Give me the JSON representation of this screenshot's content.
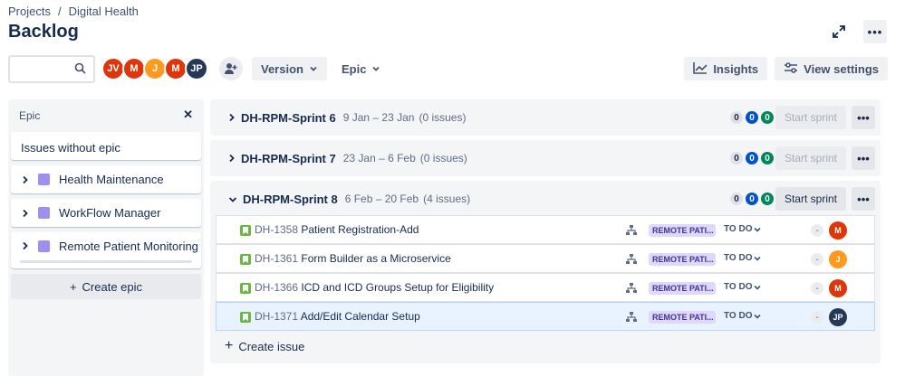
{
  "breadcrumb": {
    "items": [
      "Projects",
      "/",
      "Digital Health"
    ]
  },
  "page": {
    "title": "Backlog"
  },
  "search": {
    "placeholder": "",
    "value": ""
  },
  "avatars": [
    {
      "initials": "JV",
      "color": "#de350b"
    },
    {
      "initials": "M",
      "color": "#de350b"
    },
    {
      "initials": "J",
      "color": "#ff991f"
    },
    {
      "initials": "M",
      "color": "#de350b"
    },
    {
      "initials": "JP",
      "color": "#253858"
    }
  ],
  "toolbar": {
    "version_label": "Version",
    "epic_label": "Epic",
    "insights_label": "Insights",
    "view_settings_label": "View settings"
  },
  "epic_panel": {
    "title": "Epic",
    "without_epic": "Issues without epic",
    "epics": [
      {
        "label": "Health Maintenance",
        "color": "#9f8fef"
      },
      {
        "label": "WorkFlow Manager",
        "color": "#9f8fef"
      },
      {
        "label": "Remote Patient Monitoring",
        "color": "#9f8fef"
      }
    ],
    "create_label": "Create epic"
  },
  "sprints": [
    {
      "name": "DH-RPM-Sprint 6",
      "dates": "9 Jan – 23 Jan",
      "issues_count": "(0 issues)",
      "counts": [
        "0",
        "0",
        "0"
      ],
      "start_label": "Start sprint",
      "expanded": false
    },
    {
      "name": "DH-RPM-Sprint 7",
      "dates": "23 Jan – 6 Feb",
      "issues_count": "(0 issues)",
      "counts": [
        "0",
        "0",
        "0"
      ],
      "start_label": "Start sprint",
      "expanded": false
    },
    {
      "name": "DH-RPM-Sprint 8",
      "dates": "6 Feb – 20 Feb",
      "issues_count": "(4 issues)",
      "counts": [
        "0",
        "0",
        "0"
      ],
      "start_label": "Start sprint",
      "expanded": true
    }
  ],
  "issues": [
    {
      "key": "DH-1358",
      "summary": "Patient Registration-Add",
      "epic": "REMOTE PATI...",
      "status": "TO DO",
      "estimate": "-",
      "assignee": "M",
      "assignee_color": "#de350b"
    },
    {
      "key": "DH-1361",
      "summary": "Form Builder as a Microservice",
      "epic": "REMOTE PATI...",
      "status": "TO DO",
      "estimate": "-",
      "assignee": "J",
      "assignee_color": "#ff991f"
    },
    {
      "key": "DH-1366",
      "summary": "ICD and ICD Groups Setup for Eligibility",
      "epic": "REMOTE PATI...",
      "status": "TO DO",
      "estimate": "-",
      "assignee": "M",
      "assignee_color": "#de350b"
    },
    {
      "key": "DH-1371",
      "summary": "Add/Edit Calendar Setup",
      "epic": "REMOTE PATI...",
      "status": "TO DO",
      "estimate": "-",
      "assignee": "JP",
      "assignee_color": "#253858"
    }
  ],
  "create_issue_label": "Create issue"
}
